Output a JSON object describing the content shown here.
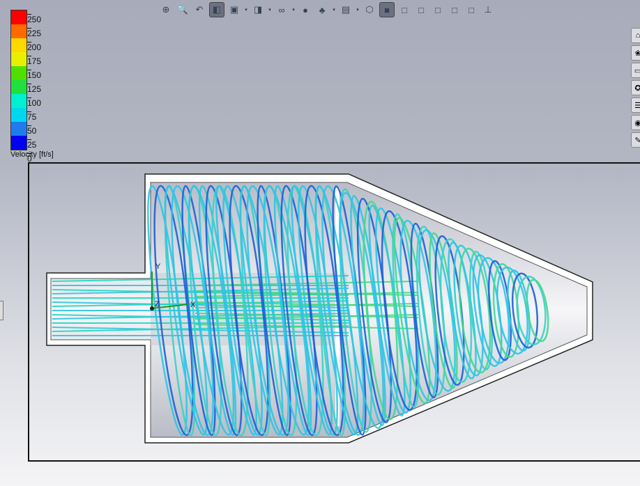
{
  "legend": {
    "title": "Velocity [ft/s]",
    "ticks": [
      "250",
      "225",
      "200",
      "175",
      "150",
      "125",
      "100",
      "75",
      "50",
      "25",
      "0"
    ],
    "colors": [
      "#ff0000",
      "#ff6a00",
      "#ffd800",
      "#e8f000",
      "#50e000",
      "#20e040",
      "#00f0d0",
      "#00d8f0",
      "#1e7cf0",
      "#0000f0"
    ]
  },
  "toolbar": {
    "items": [
      {
        "name": "zoom-to-fit-icon",
        "glyph": "⊕"
      },
      {
        "name": "zoom-to-area-icon",
        "glyph": "🔍"
      },
      {
        "name": "previous-view-icon",
        "glyph": "↶"
      },
      {
        "name": "section-view-icon",
        "glyph": "◧",
        "active": true
      },
      {
        "name": "view-orientation-icon",
        "glyph": "▣",
        "dropdown": true
      },
      {
        "name": "display-style-icon",
        "glyph": "◨",
        "dropdown": true
      },
      {
        "name": "hide-show-items-icon",
        "glyph": "∞",
        "dropdown": true
      },
      {
        "name": "edit-appearance-icon",
        "glyph": "●"
      },
      {
        "name": "apply-scene-icon",
        "glyph": "♣",
        "dropdown": true
      },
      {
        "name": "view-settings-icon",
        "glyph": "▤",
        "dropdown": true
      },
      {
        "name": "isometric-view-icon",
        "glyph": "⬡"
      },
      {
        "name": "shaded-with-edges-icon",
        "glyph": "■",
        "active": true
      },
      {
        "name": "shaded-icon",
        "glyph": "□"
      },
      {
        "name": "hidden-lines-removed-icon",
        "glyph": "□"
      },
      {
        "name": "hidden-lines-visible-icon",
        "glyph": "□"
      },
      {
        "name": "wireframe-icon",
        "glyph": "□"
      },
      {
        "name": "draft-quality-icon",
        "glyph": "□"
      },
      {
        "name": "normal-to-icon",
        "glyph": "⊥"
      }
    ]
  },
  "task_pane": [
    "home-icon",
    "design-library-icon",
    "file-explorer-icon",
    "search-icon",
    "view-palette-icon",
    "appearances-icon",
    "custom-properties-icon"
  ],
  "task_pane_glyphs": [
    "⌂",
    "❀",
    "▭",
    "✪",
    "☰",
    "◉",
    "✎"
  ],
  "triad": {
    "x": "X",
    "y": "Y",
    "z": "Z"
  },
  "colors": {
    "cyan": "#2ec4e4",
    "blue": "#1c5fd8",
    "green": "#3ed86a"
  }
}
